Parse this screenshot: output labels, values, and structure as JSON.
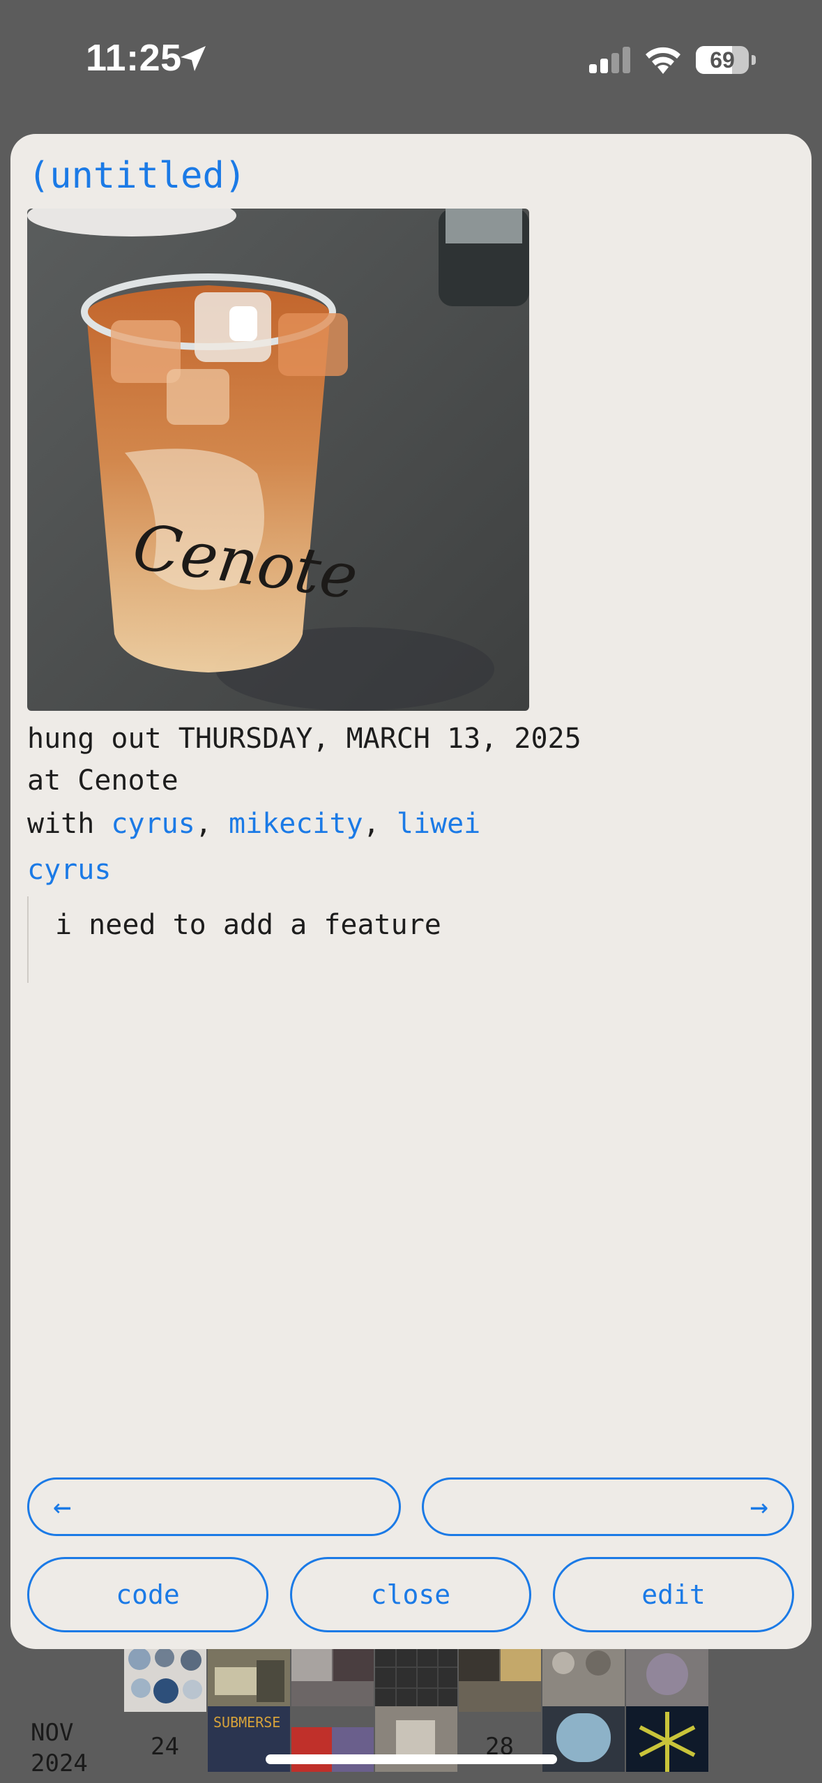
{
  "status_bar": {
    "time": "11:25",
    "battery": "69",
    "battery_level": 0.69
  },
  "entry": {
    "title": "(untitled)",
    "photo_text": "Cenote",
    "date_prefix": "hung out ",
    "date": "THURSDAY, MARCH 13, 2025",
    "location_prefix": "at ",
    "location": "Cenote",
    "with_prefix": "with ",
    "people": [
      "cyrus",
      "mikecity",
      "liwei"
    ],
    "separator": ", ",
    "author": "cyrus",
    "note": "i need to add a feature"
  },
  "buttons": {
    "prev": "←",
    "next": "→",
    "code": "code",
    "close": "close",
    "edit": "edit"
  },
  "calendar": {
    "month": "NOV",
    "year": "2024",
    "day_24": "24",
    "day_28": "28",
    "tile_label": "SUBMERSE"
  },
  "colors": {
    "accent": "#1b7ae6",
    "sheet_bg": "#eeebe7",
    "backdrop": "#5c5c5c"
  }
}
